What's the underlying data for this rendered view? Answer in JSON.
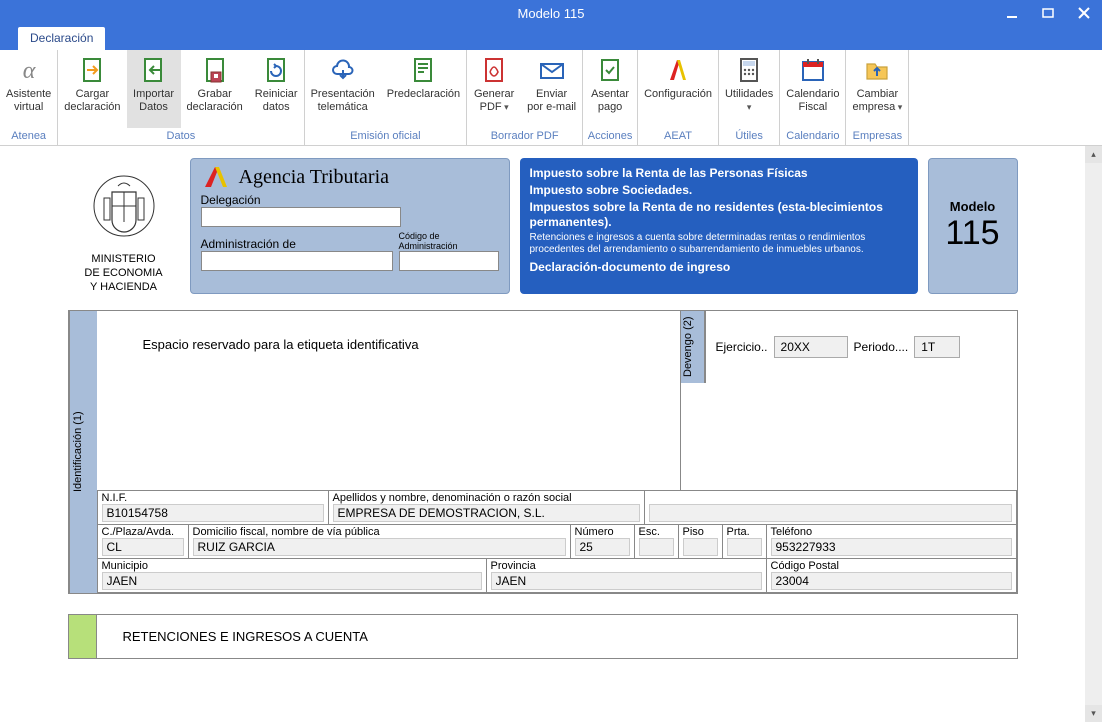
{
  "window": {
    "title": "Modelo 115"
  },
  "tabs": {
    "declaration": "Declaración"
  },
  "ribbon": {
    "groups": [
      {
        "name": "Atenea",
        "items": [
          {
            "label1": "Asistente",
            "label2": "virtual",
            "icon": "alpha",
            "id": "asistente-virtual"
          }
        ]
      },
      {
        "name": "Datos",
        "items": [
          {
            "label1": "Cargar",
            "label2": "declaración",
            "icon": "doc-in",
            "id": "cargar-declaracion"
          },
          {
            "label1": "Importar",
            "label2": "Datos",
            "icon": "doc-import",
            "id": "importar-datos",
            "active": true
          },
          {
            "label1": "Grabar",
            "label2": "declaración",
            "icon": "doc-save",
            "id": "grabar-declaracion"
          },
          {
            "label1": "Reiniciar",
            "label2": "datos",
            "icon": "doc-reset",
            "id": "reiniciar-datos"
          }
        ]
      },
      {
        "name": "Emisión oficial",
        "items": [
          {
            "label1": "Presentación",
            "label2": "telemática",
            "icon": "cloud",
            "id": "presentacion-telematica"
          },
          {
            "label1": "Predeclaración",
            "label2": "",
            "icon": "predec",
            "id": "predeclaracion"
          }
        ]
      },
      {
        "name": "Borrador PDF",
        "items": [
          {
            "label1": "Generar",
            "label2": "PDF",
            "icon": "pdf",
            "id": "generar-pdf",
            "caret": true
          },
          {
            "label1": "Enviar",
            "label2": "por e-mail",
            "icon": "mail",
            "id": "enviar-email"
          }
        ]
      },
      {
        "name": "Acciones",
        "items": [
          {
            "label1": "Asentar",
            "label2": "pago",
            "icon": "stamp",
            "id": "asentar-pago"
          }
        ]
      },
      {
        "name": "AEAT",
        "items": [
          {
            "label1": "Configuración",
            "label2": "",
            "icon": "aeat",
            "id": "configuracion-aeat"
          }
        ]
      },
      {
        "name": "Útiles",
        "items": [
          {
            "label1": "Utilidades",
            "label2": "",
            "icon": "calc",
            "id": "utilidades",
            "caret": true
          }
        ]
      },
      {
        "name": "Calendario",
        "items": [
          {
            "label1": "Calendario",
            "label2": "Fiscal",
            "icon": "calendar",
            "id": "calendario-fiscal"
          }
        ]
      },
      {
        "name": "Empresas",
        "items": [
          {
            "label1": "Cambiar",
            "label2": "empresa",
            "icon": "folder",
            "id": "cambiar-empresa",
            "caret": true
          }
        ]
      }
    ]
  },
  "doc": {
    "ministry": {
      "line1": "MINISTERIO",
      "line2": "DE ECONOMIA",
      "line3": "Y HACIENDA"
    },
    "agencia": {
      "title": "Agencia Tributaria",
      "delegacion_label": "Delegación",
      "admin_label": "Administración de",
      "codigo_label": "Código de Administración"
    },
    "blue": {
      "line1": "Impuesto sobre la Renta de las Personas Físicas",
      "line2": "Impuesto sobre Sociedades.",
      "line3": "Impuestos sobre la Renta de no residentes (esta‑blecimientos permanentes).",
      "line4": "Retenciones e ingresos a cuenta sobre determinadas rentas o rendimientos procedentes del arrendamiento o subarrendamiento de inmuebles urbanos.",
      "line5": "Declaración-documento de ingreso"
    },
    "modelo": {
      "label": "Modelo",
      "number": "115"
    },
    "ident_tab": "Identificación (1)",
    "devengo_tab": "Devengo (2)",
    "espacio_text": "Espacio reservado para la etiqueta identificativa",
    "devengo": {
      "ejercicio_label": "Ejercicio..",
      "ejercicio_value": "20XX",
      "periodo_label": "Periodo....",
      "periodo_value": "1T"
    },
    "fields": {
      "nif_label": "N.I.F.",
      "nif_value": "B10154758",
      "nombre_label": "Apellidos y nombre, denominación o razón social",
      "nombre_value": "EMPRESA DE DEMOSTRACION, S.L.",
      "calle_label": "C./Plaza/Avda.",
      "calle_value": "CL",
      "domicilio_label": "Domicilio fiscal, nombre de vía pública",
      "domicilio_value": "RUIZ GARCIA",
      "numero_label": "Número",
      "numero_value": "25",
      "esc_label": "Esc.",
      "esc_value": "",
      "piso_label": "Piso",
      "piso_value": "",
      "prta_label": "Prta.",
      "prta_value": "",
      "telefono_label": "Teléfono",
      "telefono_value": "953227933",
      "municipio_label": "Municipio",
      "municipio_value": "JAEN",
      "provincia_label": "Provincia",
      "provincia_value": "JAEN",
      "cp_label": "Código Postal",
      "cp_value": "23004"
    },
    "retenciones_title": "RETENCIONES E INGRESOS A CUENTA"
  }
}
